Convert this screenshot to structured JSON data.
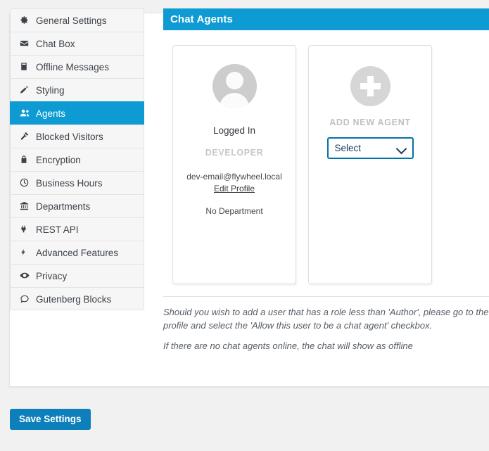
{
  "sidebar": {
    "items": [
      {
        "label": "General Settings",
        "icon": "gear-icon",
        "active": false
      },
      {
        "label": "Chat Box",
        "icon": "envelope-icon",
        "active": false
      },
      {
        "label": "Offline Messages",
        "icon": "book-icon",
        "active": false
      },
      {
        "label": "Styling",
        "icon": "pencil-icon",
        "active": false
      },
      {
        "label": "Agents",
        "icon": "users-icon",
        "active": true
      },
      {
        "label": "Blocked Visitors",
        "icon": "hammer-icon",
        "active": false
      },
      {
        "label": "Encryption",
        "icon": "lock-icon",
        "active": false
      },
      {
        "label": "Business Hours",
        "icon": "clock-icon",
        "active": false
      },
      {
        "label": "Departments",
        "icon": "bank-icon",
        "active": false
      },
      {
        "label": "REST API",
        "icon": "plug-icon",
        "active": false
      },
      {
        "label": "Advanced Features",
        "icon": "bolt-icon",
        "active": false
      },
      {
        "label": "Privacy",
        "icon": "eye-icon",
        "active": false
      },
      {
        "label": "Gutenberg Blocks",
        "icon": "chat-bubble-icon",
        "active": false
      }
    ]
  },
  "main": {
    "header_title": "Chat Agents",
    "agent_card": {
      "avatar_icon": "user-avatar-icon",
      "status": "Logged In",
      "role": "DEVELOPER",
      "email": "dev-email@flywheel.local",
      "edit_profile_label": "Edit Profile",
      "department": "No Department"
    },
    "add_card": {
      "plus_icon": "plus-circle-icon",
      "title": "ADD NEW AGENT",
      "select_value": "Select",
      "select_options": [
        "Select"
      ]
    },
    "notes": [
      "Should you wish to add a user that has a role less than 'Author', please go to the user profile and select the 'Allow this user to be a chat agent' checkbox.",
      "If there are no chat agents online, the chat will show as offline"
    ]
  },
  "footer": {
    "save_label": "Save Settings"
  },
  "colors": {
    "accent_blue": "#0e9bd4",
    "button_blue": "#0d7fbb",
    "select_border": "#0073aa",
    "page_background": "#f1f1f1",
    "muted_gray": "#c7c7c7"
  }
}
